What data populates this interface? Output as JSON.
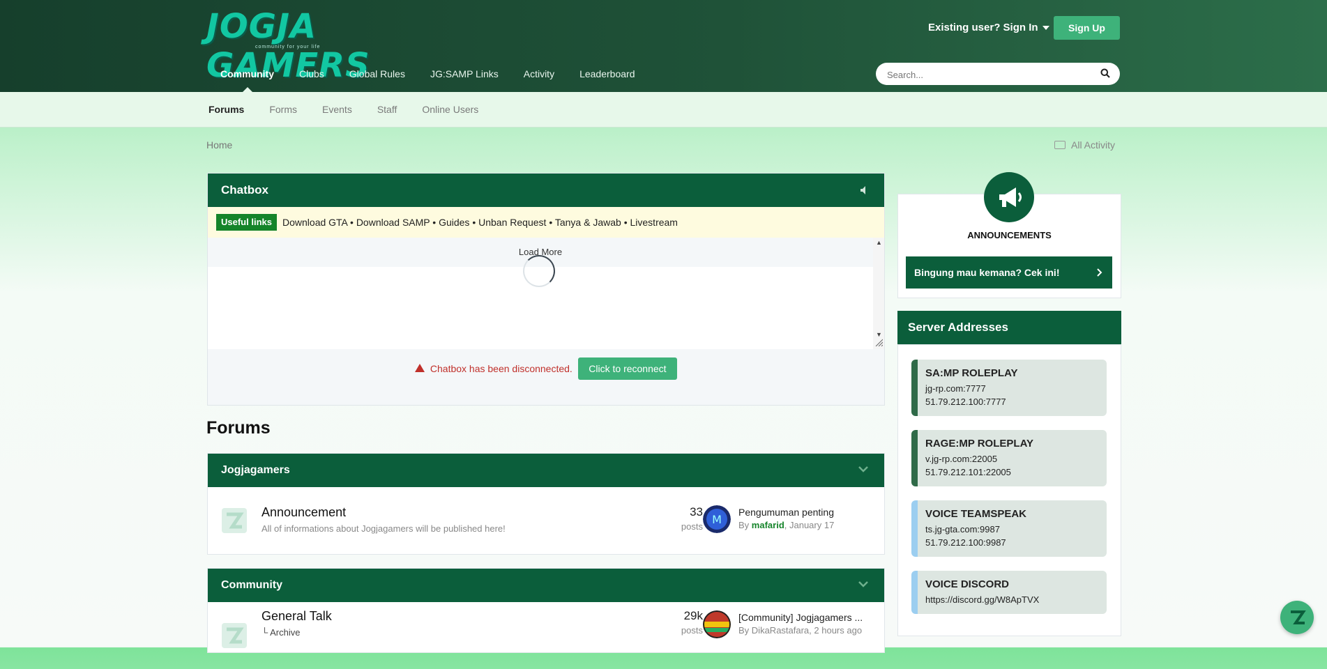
{
  "brand": {
    "logo_text": "JOGJA GAMERS",
    "tagline": "community for your life",
    "accent_color": "#0b5e3b",
    "button_color": "#3eb27a"
  },
  "header": {
    "signin_label": "Existing user? Sign In",
    "signup_label": "Sign Up",
    "search_placeholder": "Search..."
  },
  "main_nav": [
    {
      "label": "Community",
      "active": true
    },
    {
      "label": "Clubs"
    },
    {
      "label": "Global Rules"
    },
    {
      "label": "JG:SAMP Links"
    },
    {
      "label": "Activity"
    },
    {
      "label": "Leaderboard"
    }
  ],
  "sub_nav": [
    {
      "label": "Forums",
      "active": true
    },
    {
      "label": "Forms"
    },
    {
      "label": "Events"
    },
    {
      "label": "Staff"
    },
    {
      "label": "Online Users"
    }
  ],
  "breadcrumb": {
    "home": "Home",
    "all_activity": "All Activity"
  },
  "chatbox": {
    "title": "Chatbox",
    "useful_label": "Useful links",
    "links": [
      "Download GTA",
      "Download SAMP",
      "Guides",
      "Unban Request",
      "Tanya & Jawab",
      "Livestream"
    ],
    "separator": "•",
    "load_more": "Load More",
    "disconnected_msg": "Chatbox has been disconnected.",
    "reconnect_label": "Click to reconnect"
  },
  "forums": {
    "title": "Forums",
    "categories": [
      {
        "name": "Jogjagamers",
        "rows": [
          {
            "title": "Announcement",
            "description": "All of informations about Jogjagamers will be published here!",
            "count": "33",
            "count_label": "posts",
            "last_title": "Pengumuman penting",
            "last_by": "By",
            "last_author": "mafarid",
            "last_date": ", January 17"
          }
        ]
      },
      {
        "name": "Community",
        "rows": [
          {
            "title": "General Talk",
            "subforum": "Archive",
            "count": "29k",
            "count_label": "posts",
            "last_title": "[Community] Jogjagamers ...",
            "last_by": "By",
            "last_author": "DikaRastafara",
            "last_date": ", 2 hours ago"
          }
        ]
      }
    ]
  },
  "sidebar": {
    "announcements_title": "ANNOUNCEMENTS",
    "announcement_button": "Bingung mau kemana? Cek ini!",
    "servers_title": "Server Addresses",
    "servers": [
      {
        "name": "SA:MP ROLEPLAY",
        "line1": "jg-rp.com:7777",
        "line2": "51.79.212.100:7777"
      },
      {
        "name": "RAGE:MP ROLEPLAY",
        "line1": "v.jg-rp.com:22005",
        "line2": "51.79.212.101:22005"
      },
      {
        "name": "VOICE TEAMSPEAK",
        "line1": "ts.jg-gta.com:9987",
        "line2": "51.79.212.100:9987"
      },
      {
        "name": "VOICE DISCORD",
        "line1": "https://discord.gg/W8ApTVX"
      }
    ]
  }
}
